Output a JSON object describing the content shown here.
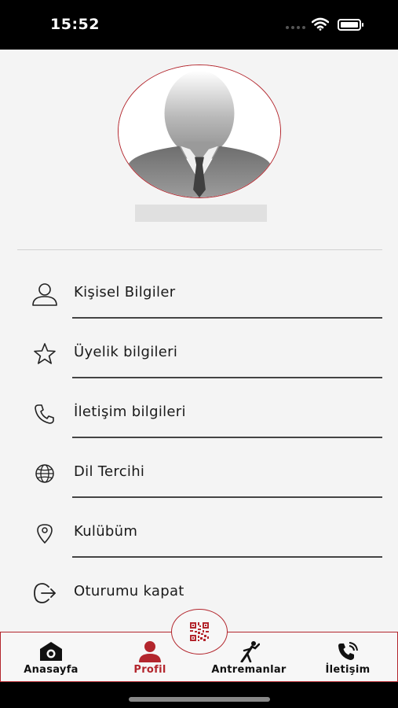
{
  "status_bar": {
    "time": "15:52"
  },
  "menu": [
    {
      "label": "Kişisel Bilgiler",
      "icon": "user-icon"
    },
    {
      "label": "Üyelik bilgileri",
      "icon": "star-icon"
    },
    {
      "label": "İletişim bilgileri",
      "icon": "phone-icon"
    },
    {
      "label": "Dil Tercihi",
      "icon": "globe-icon"
    },
    {
      "label": "Kulübüm",
      "icon": "location-pin-icon"
    },
    {
      "label": "Oturumu kapat",
      "icon": "logout-icon"
    }
  ],
  "tabs": [
    {
      "label": "Anasayfa",
      "icon": "home-camera-icon",
      "active": false
    },
    {
      "label": "Profil",
      "icon": "profile-icon",
      "active": true
    },
    {
      "label": "Antremanlar",
      "icon": "workout-icon",
      "active": false
    },
    {
      "label": "İletişim",
      "icon": "phone-call-icon",
      "active": false
    }
  ],
  "center_button": {
    "icon": "qr-code-icon"
  },
  "colors": {
    "accent": "#b3262d",
    "background": "#f4f4f4",
    "text": "#1a1a1a"
  }
}
